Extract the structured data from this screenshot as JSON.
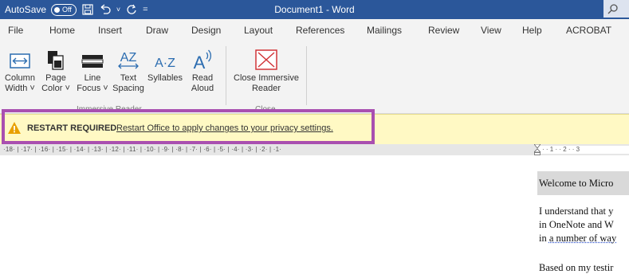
{
  "titlebar": {
    "autosave_label": "AutoSave",
    "autosave_state": "Off",
    "document_title": "Document1  -  Word",
    "icons": [
      "save-icon",
      "undo-icon",
      "redo-icon",
      "customize-icon",
      "search-icon"
    ]
  },
  "menu": {
    "tabs": [
      "File",
      "Home",
      "Insert",
      "Draw",
      "Design",
      "Layout",
      "References",
      "Mailings",
      "Review",
      "View",
      "Help",
      "ACROBAT"
    ]
  },
  "ribbon": {
    "buttons": [
      {
        "line1": "Column",
        "line2": "Width ˅",
        "icon": "column-width-icon"
      },
      {
        "line1": "Page",
        "line2": "Color ˅",
        "icon": "page-color-icon"
      },
      {
        "line1": "Line",
        "line2": "Focus ˅",
        "icon": "line-focus-icon"
      },
      {
        "line1": "Text",
        "line2": "Spacing",
        "icon": "text-spacing-icon"
      },
      {
        "line1": "Syllables",
        "line2": "",
        "icon": "syllables-icon"
      },
      {
        "line1": "Read",
        "line2": "Aloud",
        "icon": "read-aloud-icon"
      },
      {
        "line1": "Close Immersive",
        "line2": "Reader",
        "icon": "close-immersive-icon"
      }
    ],
    "groups": [
      "Immersive Reader",
      "Close"
    ]
  },
  "message_bar": {
    "title": "RESTART REQUIRED",
    "link_text": "Restart Office to apply changes to your privacy settings."
  },
  "ruler": {
    "left_text": "·18· | ·17· | ·16· | ·15· | ·14· | ·13· | ·12· | ·11· | ·10· | ·9· | ·8· | ·7· | ·6· | ·5· | ·4· | ·3· | ·2· | ·1·",
    "right_text": "· · 1 · · 2 · · 3"
  },
  "document": {
    "heading": "Welcome to Micro",
    "para_lines": [
      "I understand that y",
      "in OneNote and W",
      "in "
    ],
    "para_squiggle": "a number of way",
    "para2": "Based on my testir"
  },
  "colors": {
    "titlebar": "#2b579a",
    "message_bar": "#fff9c4",
    "highlight": "#a94fb0",
    "warning": "#e8a000"
  }
}
